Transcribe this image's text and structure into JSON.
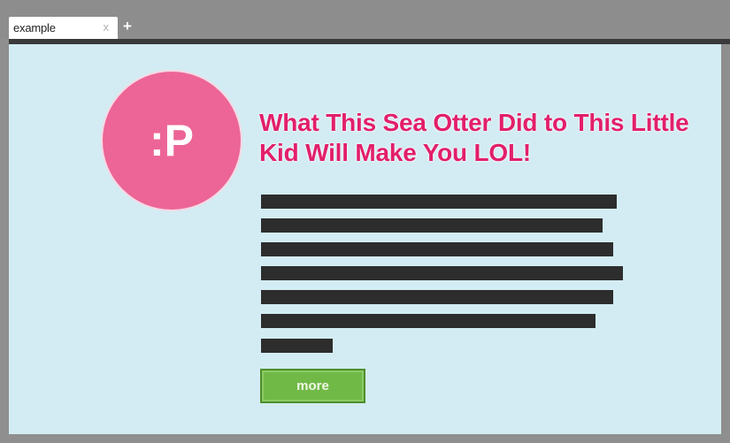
{
  "browser": {
    "tab": {
      "title": "example",
      "close_glyph": "x"
    },
    "new_tab_glyph": "+"
  },
  "page": {
    "avatar_text": ":P",
    "headline": "What This Sea Otter Did to This Little Kid Will Make You LOL!",
    "redacted_lines": 7,
    "more_label": "more"
  },
  "colors": {
    "background": "#d3ecf3",
    "avatar": "#ec6596",
    "headline": "#e21f6a",
    "button": "#71b947",
    "redaction": "#2d2d2d"
  }
}
